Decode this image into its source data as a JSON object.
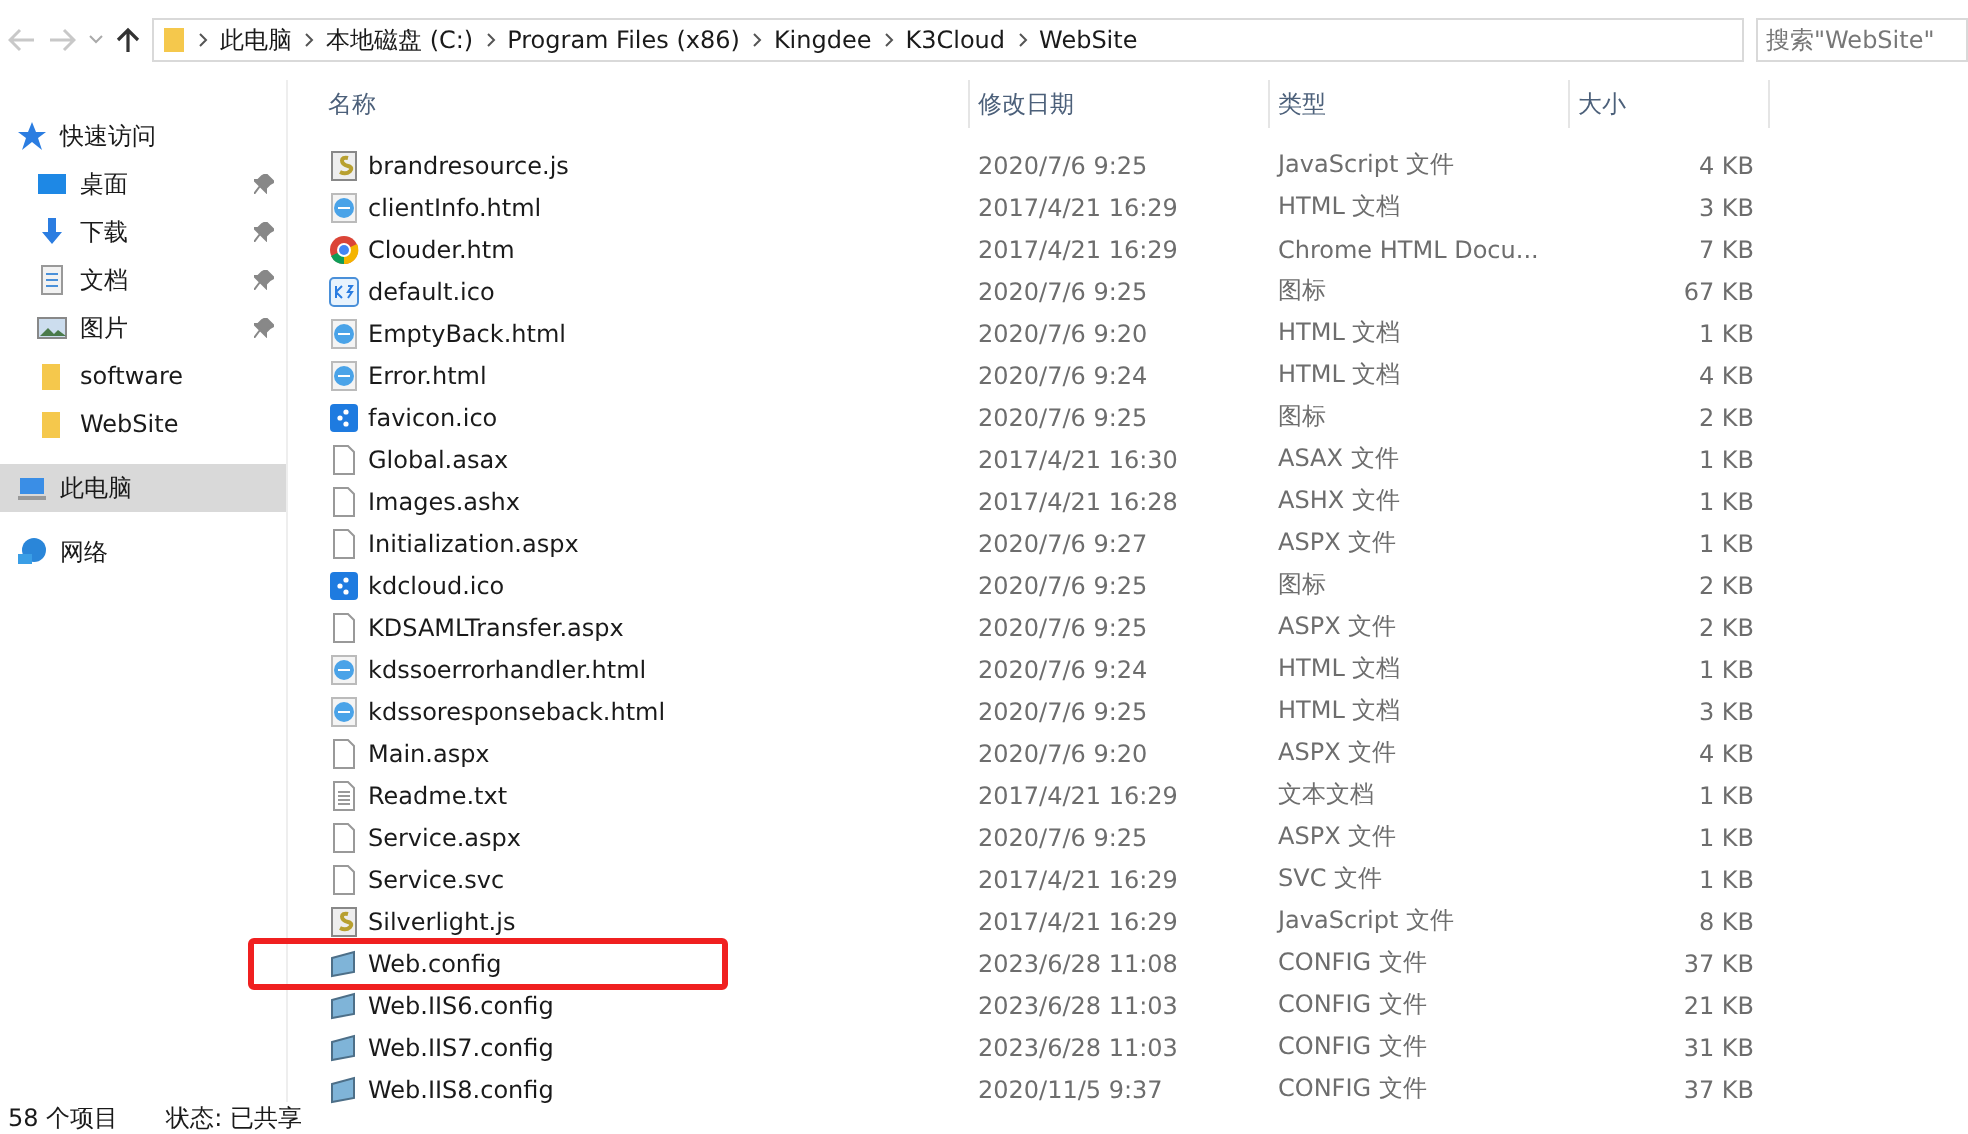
{
  "address_bar": {
    "crumbs": [
      "此电脑",
      "本地磁盘 (C:)",
      "Program Files (x86)",
      "Kingdee",
      "K3Cloud",
      "WebSite"
    ]
  },
  "search": {
    "placeholder": "搜索\"WebSite\""
  },
  "sidebar": {
    "items": [
      {
        "kind": "star",
        "label": "快速访问",
        "selected": false,
        "children": [
          {
            "kind": "desktop",
            "label": "桌面",
            "selected": false,
            "pinned": true
          },
          {
            "kind": "download",
            "label": "下载",
            "selected": false,
            "pinned": true
          },
          {
            "kind": "document",
            "label": "文档",
            "selected": false,
            "pinned": true
          },
          {
            "kind": "picture",
            "label": "图片",
            "selected": false,
            "pinned": true
          },
          {
            "kind": "folder",
            "label": "software",
            "selected": false,
            "pinned": false
          },
          {
            "kind": "folder",
            "label": "WebSite",
            "selected": false,
            "pinned": false
          }
        ]
      },
      {
        "kind": "computer",
        "label": "此电脑",
        "selected": true
      },
      {
        "kind": "network",
        "label": "网络",
        "selected": false
      }
    ]
  },
  "table": {
    "columns": [
      "名称",
      "修改日期",
      "类型",
      "大小"
    ],
    "rows": [
      {
        "kind": "script",
        "name": "brandresource.js",
        "date": "2020/7/6 9:25",
        "type": "JavaScript 文件",
        "size": "4 KB",
        "highlighted": false
      },
      {
        "kind": "ie",
        "name": "clientInfo.html",
        "date": "2017/4/21 16:29",
        "type": "HTML 文档",
        "size": "3 KB",
        "highlighted": false
      },
      {
        "kind": "chrome",
        "name": "Clouder.htm",
        "date": "2017/4/21 16:29",
        "type": "Chrome HTML Docu...",
        "size": "7 KB",
        "highlighted": false
      },
      {
        "kind": "k3",
        "name": "default.ico",
        "date": "2020/7/6 9:25",
        "type": "图标",
        "size": "67 KB",
        "highlighted": false
      },
      {
        "kind": "ie",
        "name": "EmptyBack.html",
        "date": "2020/7/6 9:20",
        "type": "HTML 文档",
        "size": "1 KB",
        "highlighted": false
      },
      {
        "kind": "ie",
        "name": "Error.html",
        "date": "2020/7/6 9:24",
        "type": "HTML 文档",
        "size": "4 KB",
        "highlighted": false
      },
      {
        "kind": "kd",
        "name": "favicon.ico",
        "date": "2020/7/6 9:25",
        "type": "图标",
        "size": "2 KB",
        "highlighted": false
      },
      {
        "kind": "blank",
        "name": "Global.asax",
        "date": "2017/4/21 16:30",
        "type": "ASAX 文件",
        "size": "1 KB",
        "highlighted": false
      },
      {
        "kind": "blank",
        "name": "Images.ashx",
        "date": "2017/4/21 16:28",
        "type": "ASHX 文件",
        "size": "1 KB",
        "highlighted": false
      },
      {
        "kind": "blank",
        "name": "Initialization.aspx",
        "date": "2020/7/6 9:27",
        "type": "ASPX 文件",
        "size": "1 KB",
        "highlighted": false
      },
      {
        "kind": "kd",
        "name": "kdcloud.ico",
        "date": "2020/7/6 9:25",
        "type": "图标",
        "size": "2 KB",
        "highlighted": false
      },
      {
        "kind": "blank",
        "name": "KDSAMLTransfer.aspx",
        "date": "2020/7/6 9:25",
        "type": "ASPX 文件",
        "size": "2 KB",
        "highlighted": false
      },
      {
        "kind": "ie",
        "name": "kdssoerrorhandler.html",
        "date": "2020/7/6 9:24",
        "type": "HTML 文档",
        "size": "1 KB",
        "highlighted": false
      },
      {
        "kind": "ie",
        "name": "kdssoresponseback.html",
        "date": "2020/7/6 9:25",
        "type": "HTML 文档",
        "size": "3 KB",
        "highlighted": false
      },
      {
        "kind": "blank",
        "name": "Main.aspx",
        "date": "2020/7/6 9:20",
        "type": "ASPX 文件",
        "size": "4 KB",
        "highlighted": false
      },
      {
        "kind": "text",
        "name": "Readme.txt",
        "date": "2017/4/21 16:29",
        "type": "文本文档",
        "size": "1 KB",
        "highlighted": false
      },
      {
        "kind": "blank",
        "name": "Service.aspx",
        "date": "2020/7/6 9:25",
        "type": "ASPX 文件",
        "size": "1 KB",
        "highlighted": false
      },
      {
        "kind": "blank",
        "name": "Service.svc",
        "date": "2017/4/21 16:29",
        "type": "SVC 文件",
        "size": "1 KB",
        "highlighted": false
      },
      {
        "kind": "script",
        "name": "Silverlight.js",
        "date": "2017/4/21 16:29",
        "type": "JavaScript 文件",
        "size": "8 KB",
        "highlighted": false
      },
      {
        "kind": "config",
        "name": "Web.config",
        "date": "2023/6/28 11:08",
        "type": "CONFIG 文件",
        "size": "37 KB",
        "highlighted": true
      },
      {
        "kind": "config",
        "name": "Web.IIS6.config",
        "date": "2023/6/28 11:03",
        "type": "CONFIG 文件",
        "size": "21 KB",
        "highlighted": false
      },
      {
        "kind": "config",
        "name": "Web.IIS7.config",
        "date": "2023/6/28 11:03",
        "type": "CONFIG 文件",
        "size": "31 KB",
        "highlighted": false
      },
      {
        "kind": "config",
        "name": "Web.IIS8.config",
        "date": "2020/11/5 9:37",
        "type": "CONFIG 文件",
        "size": "37 KB",
        "highlighted": false
      }
    ]
  },
  "status_bar": {
    "count": "58 个项目",
    "state": "状态: 已共享"
  }
}
